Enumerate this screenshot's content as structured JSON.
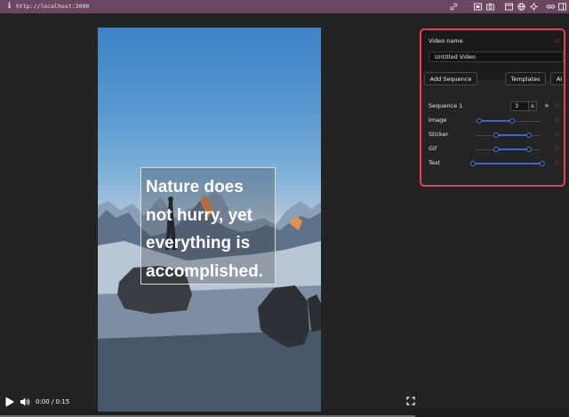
{
  "browser": {
    "url": "http://localhost:3000",
    "icons": [
      "info-icon",
      "link-icon",
      "screenshot-icon",
      "camera-icon",
      "window-icon",
      "globe-icon",
      "settings-icon",
      "code-icon",
      "sidebar-icon"
    ]
  },
  "video": {
    "caption": "Nature does\nnot hurry, yet\neverything is\naccomplished.",
    "time": "0:00 / 0:15",
    "progress": 0.0
  },
  "panel": {
    "border_color": "#e0435f",
    "video_name_label": "Video name",
    "video_name_value": "Untitled Video",
    "add_sequence_label": "Add Sequence",
    "templates_label": "Templates",
    "ai_label": "AI",
    "sequence": {
      "label": "Sequence 1",
      "duration": "3",
      "unit": "s",
      "add_symbol": "+"
    },
    "tracks": [
      {
        "label": "Image",
        "start": 0.05,
        "end": 0.55
      },
      {
        "label": "Sticker",
        "start": 0.3,
        "end": 0.8
      },
      {
        "label": "Gif",
        "start": 0.3,
        "end": 0.8
      },
      {
        "label": "Text",
        "start": 0.0,
        "end": 0.95
      }
    ],
    "grip_symbol": "::"
  }
}
